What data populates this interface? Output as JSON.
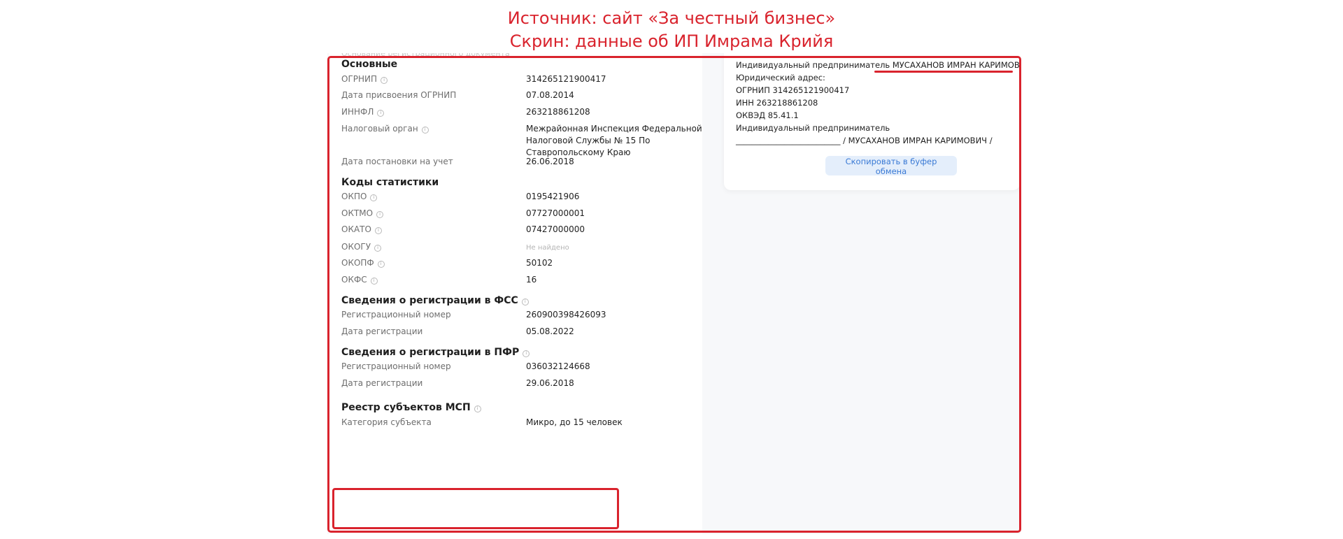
{
  "caption": {
    "line1": "Источник: сайт «За честный бизнес»",
    "line2": "Скрин: данные об ИП Имрама Крийя"
  },
  "left": {
    "cut_text": "Основание регистрационного документа",
    "sections": {
      "main": {
        "title": "Основные",
        "rows": [
          {
            "label": "ОГРНИП",
            "value": "314265121900417"
          },
          {
            "label": "Дата присвоения ОГРНИП",
            "value": "07.08.2014"
          },
          {
            "label": "ИННФЛ",
            "value": "263218861208"
          },
          {
            "label": "Налоговый орган",
            "value_lines": [
              "Межрайонная Инспекция Федеральной",
              "Налоговой Службы № 15 По",
              "Ставропольскому Краю"
            ]
          },
          {
            "label": "Дата постановки на учет",
            "value": "26.06.2018"
          }
        ]
      },
      "stats": {
        "title": "Коды статистики",
        "rows": [
          {
            "label": "ОКПО",
            "value": "0195421906"
          },
          {
            "label": "ОКТМО",
            "value": "07727000001"
          },
          {
            "label": "ОКАТО",
            "value": "07427000000"
          },
          {
            "label": "ОКОГУ",
            "value": "Не найдено"
          },
          {
            "label": "ОКОПФ",
            "value": "50102"
          },
          {
            "label": "ОКФС",
            "value": "16"
          }
        ]
      },
      "fss": {
        "title": "Сведения о регистрации в ФСС",
        "rows": [
          {
            "label": "Регистрационный номер",
            "value": "260900398426093"
          },
          {
            "label": "Дата регистрации",
            "value": "05.08.2022"
          }
        ]
      },
      "pfr": {
        "title": "Сведения о регистрации в ПФР",
        "rows": [
          {
            "label": "Регистрационный номер",
            "value": "036032124668"
          },
          {
            "label": "Дата регистрации",
            "value": "29.06.2018"
          }
        ]
      },
      "msp": {
        "title": "Реестр субъектов МСП",
        "rows": [
          {
            "label": "Категория субъекта",
            "value": "Микро, до 15 человек"
          }
        ]
      }
    }
  },
  "right": {
    "line1_prefix": "Индивидуальный предприниматель ",
    "line1_name": "МУСАХАНОВ ИМРАН КАРИМОВИЧ",
    "line2": "Юридический адрес:",
    "line3": "ОГРНИП 314265121900417",
    "line4": "ИНН 263218861208",
    "line5": "ОКВЭД 85.41.1",
    "line6": "Индивидуальный предприниматель",
    "line7": "__________________________ / МУСАХАНОВ ИМРАН КАРИМОВИЧ /",
    "copy_button": "Скопировать в буфер обмена"
  },
  "colors": {
    "annotation_red": "#d9232d",
    "button_bg": "#e4eefb",
    "button_text": "#3a7ad5"
  },
  "icons": {
    "info": "info-circle-icon"
  }
}
